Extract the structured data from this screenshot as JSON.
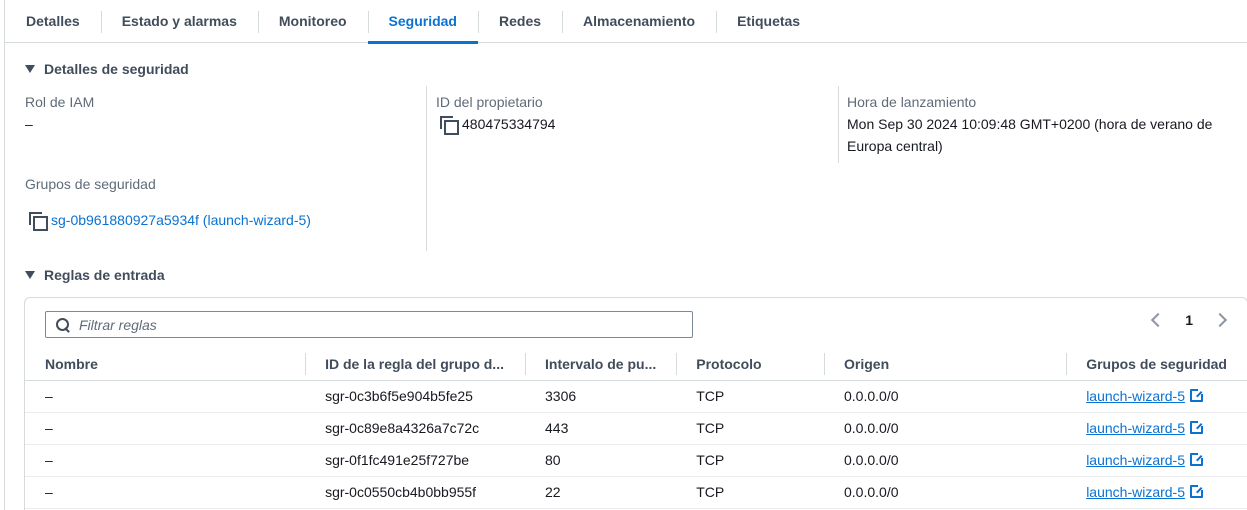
{
  "tabs": [
    {
      "label": "Detalles"
    },
    {
      "label": "Estado y alarmas"
    },
    {
      "label": "Monitoreo"
    },
    {
      "label": "Seguridad",
      "active": true
    },
    {
      "label": "Redes"
    },
    {
      "label": "Almacenamiento"
    },
    {
      "label": "Etiquetas"
    }
  ],
  "security_details": {
    "title": "Detalles de seguridad",
    "iam_role": {
      "label": "Rol de IAM",
      "value": "–"
    },
    "owner_id": {
      "label": "ID del propietario",
      "value": "480475334794"
    },
    "launch_time": {
      "label": "Hora de lanzamiento",
      "value_line1": "Mon Sep 30 2024 10:09:48 GMT+0200 (hora de verano de",
      "value_line2": "Europa central)"
    },
    "security_groups": {
      "label": "Grupos de seguridad",
      "value": "sg-0b961880927a5934f (launch-wizard-5)"
    }
  },
  "inbound_rules": {
    "title": "Reglas de entrada",
    "filter_placeholder": "Filtrar reglas",
    "page": "1",
    "columns": [
      "Nombre",
      "ID de la regla del grupo d...",
      "Intervalo de pu...",
      "Protocolo",
      "Origen",
      "Grupos de seguridad"
    ],
    "rows": [
      {
        "name": "–",
        "rule_id": "sgr-0c3b6f5e904b5fe25",
        "port": "3306",
        "protocol": "TCP",
        "source": "0.0.0.0/0",
        "group": "launch-wizard-5"
      },
      {
        "name": "–",
        "rule_id": "sgr-0c89e8a4326a7c72c",
        "port": "443",
        "protocol": "TCP",
        "source": "0.0.0.0/0",
        "group": "launch-wizard-5"
      },
      {
        "name": "–",
        "rule_id": "sgr-0f1fc491e25f727be",
        "port": "80",
        "protocol": "TCP",
        "source": "0.0.0.0/0",
        "group": "launch-wizard-5"
      },
      {
        "name": "–",
        "rule_id": "sgr-0c0550cb4b0bb955f",
        "port": "22",
        "protocol": "TCP",
        "source": "0.0.0.0/0",
        "group": "launch-wizard-5"
      }
    ]
  },
  "colors": {
    "accent": "#0972d3",
    "text": "#16191f",
    "muted": "#5f6b7a",
    "border": "#d5dbdb"
  }
}
